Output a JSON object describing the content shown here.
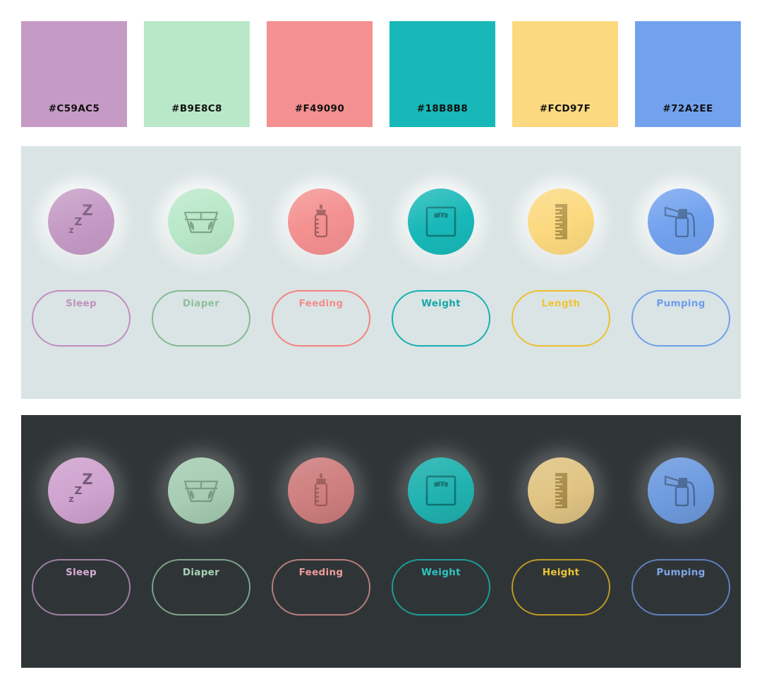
{
  "swatches": [
    {
      "hex": "#C59AC5",
      "label": "#C59AC5",
      "name": "sleep"
    },
    {
      "hex": "#B9E8C8",
      "label": "#B9E8C8",
      "name": "diaper"
    },
    {
      "hex": "#F49090",
      "label": "#F49090",
      "name": "feeding"
    },
    {
      "hex": "#18B8B8",
      "label": "#18B8B8",
      "name": "weight"
    },
    {
      "hex": "#FCD97F",
      "label": "#FCD97F",
      "name": "length"
    },
    {
      "hex": "#72A2EE",
      "label": "#72A2EE",
      "name": "pumping"
    }
  ],
  "light_panel": {
    "background": "#DAE4E4",
    "icons": [
      {
        "name": "sleep-icon",
        "fill": "#C59AC5",
        "glyph": "#7E6080"
      },
      {
        "name": "diaper-icon",
        "fill": "#B9E8C8",
        "glyph": "#7FA58B"
      },
      {
        "name": "feeding-icon",
        "fill": "#F49090",
        "glyph": "#A35F60"
      },
      {
        "name": "weight-icon",
        "fill": "#18B8B8",
        "glyph": "#0E7B7B"
      },
      {
        "name": "length-icon",
        "fill": "#FCD97F",
        "glyph": "#B89A50"
      },
      {
        "name": "pumping-icon",
        "fill": "#72A2EE",
        "glyph": "#4B6E9E"
      }
    ],
    "pills": [
      {
        "label": "Sleep",
        "border": "#C08CC0",
        "text": "#BE93BE"
      },
      {
        "label": "Diaper",
        "border": "#85B894",
        "text": "#8FBF9D"
      },
      {
        "label": "Feeding",
        "border": "#F4817F",
        "text": "#F38D8C"
      },
      {
        "label": "Weight",
        "border": "#16B0B0",
        "text": "#1AA6A6"
      },
      {
        "label": "Length",
        "border": "#EDBE2E",
        "text": "#EFC43A"
      },
      {
        "label": "Pumping",
        "border": "#6F9FEB",
        "text": "#6C9DEA"
      }
    ]
  },
  "dark_panel": {
    "background": "#2F3537",
    "icons": [
      {
        "name": "sleep-icon",
        "fill": "#CFA3CF",
        "glyph": "#6E5672"
      },
      {
        "name": "diaper-icon",
        "fill": "#A7CDB3",
        "glyph": "#7A9C86"
      },
      {
        "name": "feeding-icon",
        "fill": "#CE7E7E",
        "glyph": "#9A5B5C"
      },
      {
        "name": "weight-icon",
        "fill": "#20B2B0",
        "glyph": "#0F7575"
      },
      {
        "name": "length-icon",
        "fill": "#E0C484",
        "glyph": "#A88D4C"
      },
      {
        "name": "pumping-icon",
        "fill": "#6E9BDF",
        "glyph": "#486793"
      }
    ],
    "pills": [
      {
        "label": "Sleep",
        "border": "#A07FA4",
        "text": "#D6AEDA"
      },
      {
        "label": "Diaper",
        "border": "#7FA38C",
        "text": "#A9D3B6"
      },
      {
        "label": "Feeding",
        "border": "#B97E7E",
        "text": "#F09C9C"
      },
      {
        "label": "Weight",
        "border": "#1E9C9A",
        "text": "#2FC4C0"
      },
      {
        "label": "Height",
        "border": "#BE9A24",
        "text": "#EDC536"
      },
      {
        "label": "Pumping",
        "border": "#5E80BD",
        "text": "#7FA6E6"
      }
    ]
  }
}
